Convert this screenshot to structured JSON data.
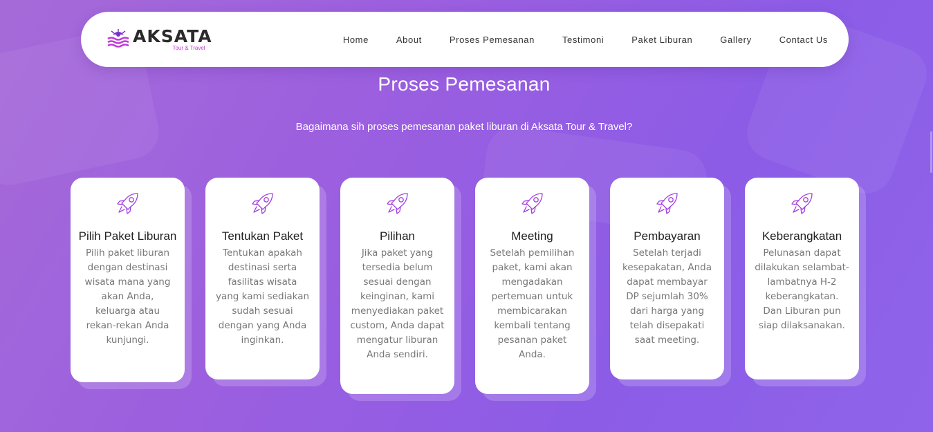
{
  "brand": {
    "name": "AKSATA",
    "tagline": "Tour & Travel"
  },
  "nav": [
    {
      "label": "Home"
    },
    {
      "label": "About"
    },
    {
      "label": "Proses Pemesanan"
    },
    {
      "label": "Testimoni"
    },
    {
      "label": "Paket Liburan"
    },
    {
      "label": "Gallery"
    },
    {
      "label": "Contact Us"
    }
  ],
  "section": {
    "title": "Proses Pemesanan",
    "subtitle": "Bagaimana sih proses pemesanan paket liburan di Aksata Tour & Travel?"
  },
  "steps": [
    {
      "title": "Pilih Paket Liburan",
      "text": "Pilih paket liburan dengan destinasi wisata mana yang akan Anda, keluarga atau rekan-rekan Anda kunjungi.",
      "icon": "rocket-icon"
    },
    {
      "title": "Tentukan Paket",
      "text": "Tentukan apakah destinasi serta fasilitas wisata yang kami sediakan sudah sesuai dengan yang Anda inginkan.",
      "icon": "rocket-icon"
    },
    {
      "title": "Pilihan",
      "text": "Jika paket yang tersedia belum sesuai dengan keinginan, kami menyediakan paket custom, Anda dapat mengatur liburan Anda sendiri.",
      "icon": "rocket-icon"
    },
    {
      "title": "Meeting",
      "text": "Setelah pemilihan paket, kami akan mengadakan pertemuan untuk membicarakan kembali tentang pesanan paket Anda.",
      "icon": "rocket-icon"
    },
    {
      "title": "Pembayaran",
      "text": "Setelah terjadi kesepakatan, Anda dapat membayar DP sejumlah 30% dari harga yang telah disepakati saat meeting.",
      "icon": "rocket-icon"
    },
    {
      "title": "Keberangkatan",
      "text": "Pelunasan dapat dilakukan selambat-lambatnya H-2 keberangkatan. Dan Liburan pun siap dilaksanakan.",
      "icon": "rocket-icon"
    }
  ],
  "colors": {
    "accent": "#a13fe0",
    "logo_pink": "#c13bd8",
    "logo_purple": "#7b2fd0"
  }
}
